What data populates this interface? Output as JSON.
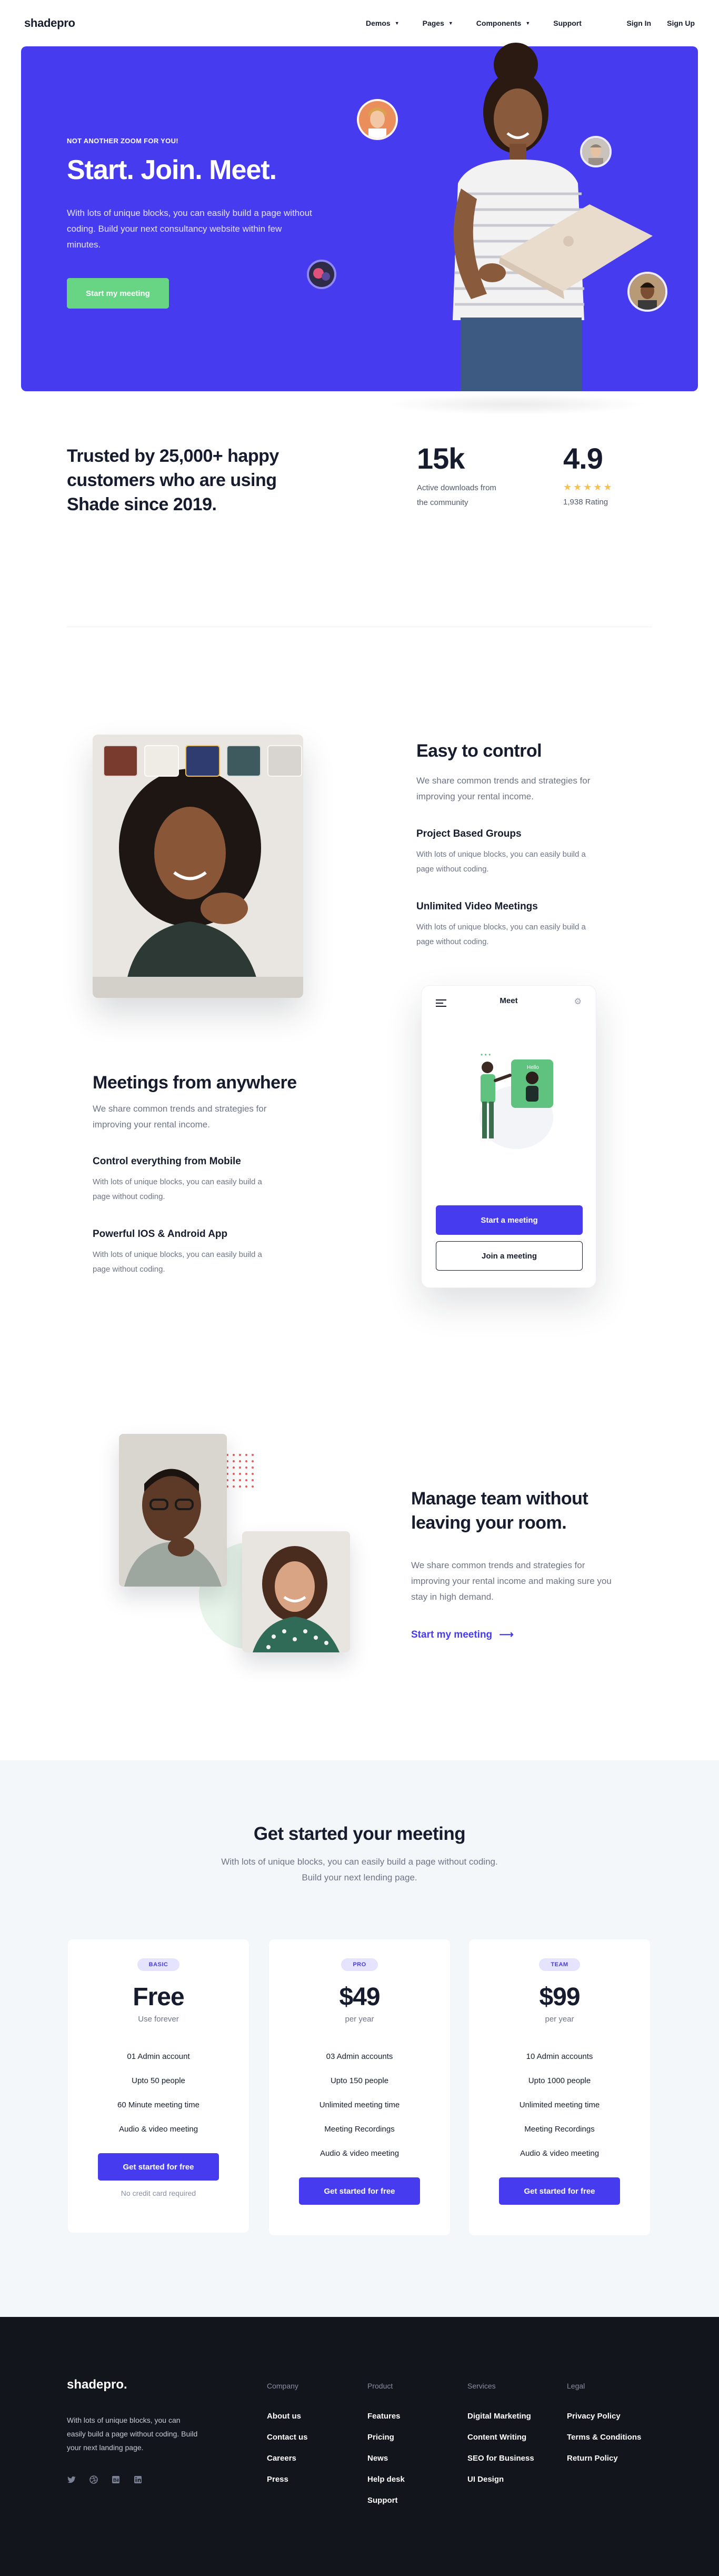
{
  "nav": {
    "logo": "shadepro",
    "menu": [
      {
        "label": "Demos"
      },
      {
        "label": "Pages"
      },
      {
        "label": "Components"
      },
      {
        "label": "Support"
      }
    ],
    "sign_in": "Sign In",
    "sign_up": "Sign Up"
  },
  "hero": {
    "eyebrow": "NOT ANOTHER ZOOM FOR YOU!",
    "title": "Start. Join. Meet.",
    "text": "With lots of unique blocks, you can easily build a page without coding. Build your next consultancy website within few minutes.",
    "cta": "Start my meeting",
    "accent": "#473bf0",
    "cta_color": "#68d585"
  },
  "trust": {
    "title": "Trusted by 25,000+ happy customers who are using Shade since 2019.",
    "downloads_value": "15k",
    "downloads_label": "Active downloads from the community",
    "rating_value": "4.9",
    "rating_stars": "★★★★★",
    "rating_label": "1,938 Rating"
  },
  "feature1": {
    "title": "Easy to control",
    "text": "We share common trends and strategies for improving your rental income.",
    "items": [
      {
        "title": "Project Based Groups",
        "text": "With lots of unique blocks, you can easily build a page without coding."
      },
      {
        "title": "Unlimited Video Meetings",
        "text": "With lots of unique blocks, you can easily build a page without coding."
      }
    ]
  },
  "feature2": {
    "title": "Meetings from anywhere",
    "text": "We share common trends and strategies for improving your rental income.",
    "items": [
      {
        "title": "Control everything from Mobile",
        "text": "With lots of unique blocks, you can easily build a page without coding."
      },
      {
        "title": "Powerful IOS & Android App",
        "text": "With lots of unique blocks, you can easily build a page without coding."
      }
    ],
    "phone": {
      "title": "Meet",
      "start_btn": "Start a meeting",
      "join_btn": "Join a meeting"
    }
  },
  "feature3": {
    "title": "Manage team without leaving your room.",
    "text": "We share common trends and strategies for improving your rental income and making sure you stay in high demand.",
    "link": "Start my meeting",
    "arrow": "⟶"
  },
  "pricing": {
    "title": "Get started your meeting",
    "subtitle": "With lots of unique blocks, you can easily build a page without coding. Build your next lending page.",
    "plans": [
      {
        "badge": "BASIC",
        "price": "Free",
        "period": "Use forever",
        "features": [
          "01 Admin account",
          "Upto 50 people",
          "60 Minute meeting time",
          "Audio & video meeting"
        ],
        "button": "Get started for free",
        "note": "No credit card required"
      },
      {
        "badge": "PRO",
        "price": "$49",
        "period": "per year",
        "features": [
          "03 Admin accounts",
          "Upto 150 people",
          "Unlimited meeting time",
          "Meeting Recordings",
          "Audio & video meeting"
        ],
        "button": "Get started for free"
      },
      {
        "badge": "TEAM",
        "price": "$99",
        "period": "per year",
        "features": [
          "10 Admin accounts",
          "Upto 1000 people",
          "Unlimited meeting time",
          "Meeting Recordings",
          "Audio & video meeting"
        ],
        "button": "Get started for free"
      }
    ]
  },
  "footer": {
    "logo": "shadepro.",
    "description": "With lots of unique blocks, you can easily build a page without coding. Build your next landing page.",
    "socials": [
      "twitter-icon",
      "dribbble-icon",
      "behance-icon",
      "linkedin-icon"
    ],
    "columns": [
      {
        "heading": "Company",
        "links": [
          "About us",
          "Contact us",
          "Careers",
          "Press"
        ]
      },
      {
        "heading": "Product",
        "links": [
          "Features",
          "Pricing",
          "News",
          "Help desk",
          "Support"
        ]
      },
      {
        "heading": "Services",
        "links": [
          "Digital Marketing",
          "Content Writing",
          "SEO for Business",
          "UI Design"
        ]
      },
      {
        "heading": "Legal",
        "links": [
          "Privacy Policy",
          "Terms & Conditions",
          "Return Policy"
        ]
      }
    ]
  }
}
